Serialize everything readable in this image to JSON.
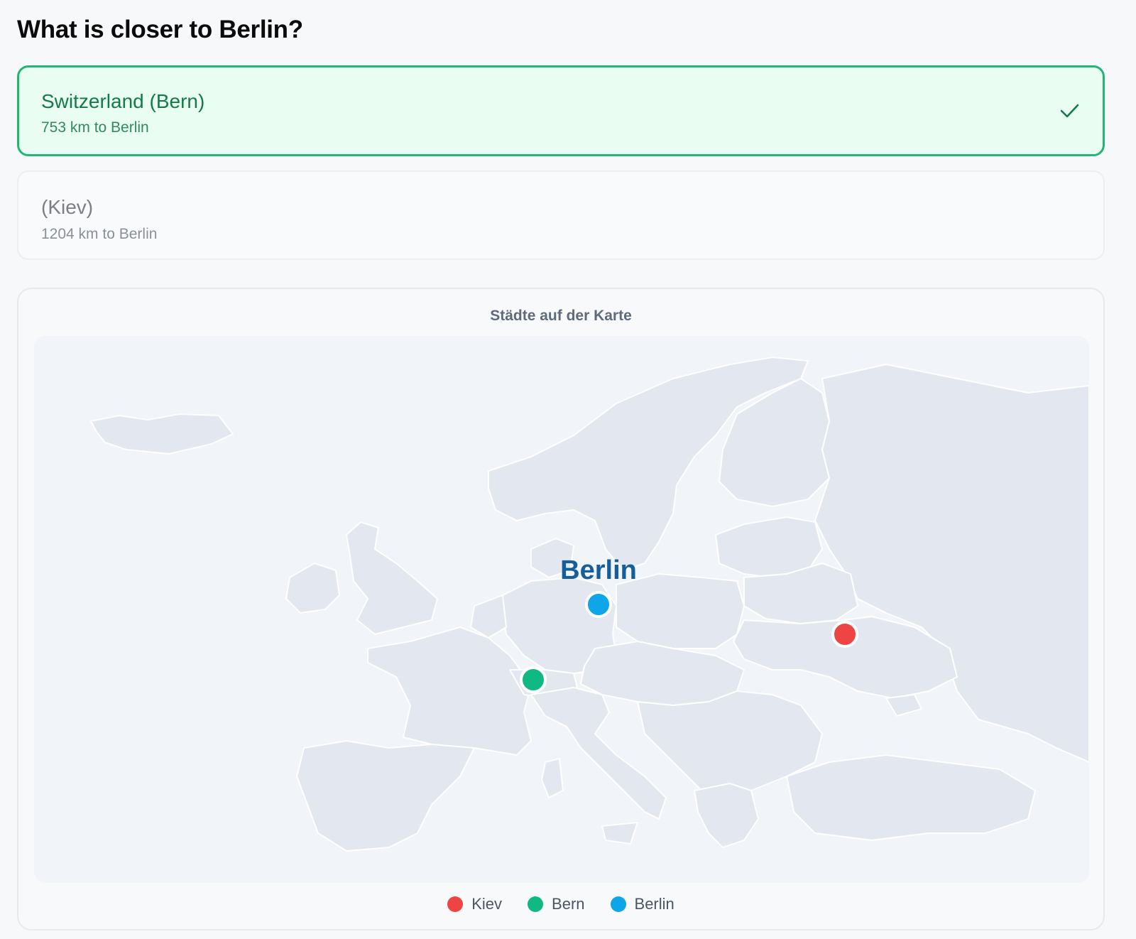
{
  "question": "What is closer to Berlin?",
  "options": [
    {
      "title": "Switzerland (Bern)",
      "subtitle": "753 km to Berlin",
      "state": "correct",
      "status_icon": "checkmark-icon"
    },
    {
      "title": "(Kiev)",
      "subtitle": "1204 km to Berlin",
      "state": "neutral"
    }
  ],
  "map": {
    "title": "Städte auf der Karte",
    "highlight_label": "Berlin",
    "markers": [
      {
        "name": "Kiev",
        "color": "#ef4444"
      },
      {
        "name": "Bern",
        "color": "#10b981"
      },
      {
        "name": "Berlin",
        "color": "#0ea5e9"
      }
    ]
  },
  "legend": [
    {
      "label": "Kiev",
      "color": "#ef4444"
    },
    {
      "label": "Bern",
      "color": "#10b981"
    },
    {
      "label": "Berlin",
      "color": "#0ea5e9"
    }
  ],
  "colors": {
    "correct_border": "#22b573",
    "correct_bg": "#eafdf2",
    "correct_text": "#127a4b",
    "berlin_label": "#155e9a",
    "land": "#e3e8f0",
    "sea": "#f1f4f8"
  }
}
